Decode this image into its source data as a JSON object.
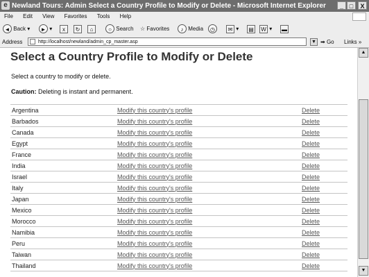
{
  "window": {
    "title": "Newland Tours: Admin Select a Country Profile to Modify or Delete - Microsoft Internet Explorer",
    "buttons": [
      "_",
      "□",
      "X"
    ]
  },
  "menu": [
    "File",
    "Edit",
    "View",
    "Favorites",
    "Tools",
    "Help"
  ],
  "toolbar": {
    "back": "Back",
    "search": "Search",
    "favorites": "Favorites",
    "media": "Media"
  },
  "address": {
    "label": "Address",
    "url": "http://localhost/newland/admin_cp_master.asp",
    "go": "Go",
    "links": "Links"
  },
  "page": {
    "heading": "Select a Country Profile to Modify or Delete",
    "intro": "Select a country to modify or delete.",
    "caution_label": "Caution:",
    "caution_text": "Deleting is instant and permanent."
  },
  "countries": [
    {
      "name": "Argentina",
      "modify": "Modify this country's profile",
      "delete": "Delete"
    },
    {
      "name": "Barbados",
      "modify": "Modify this country's profile",
      "delete": "Delete"
    },
    {
      "name": "Canada",
      "modify": "Modify this country's profile",
      "delete": "Delete"
    },
    {
      "name": "Egypt",
      "modify": "Modify this country's profile",
      "delete": "Delete"
    },
    {
      "name": "France",
      "modify": "Modify this country's profile",
      "delete": "Delete"
    },
    {
      "name": "India",
      "modify": "Modify this country's profile",
      "delete": "Delete"
    },
    {
      "name": "Israel",
      "modify": "Modify this country's profile",
      "delete": "Delete"
    },
    {
      "name": "Italy",
      "modify": "Modify this country's profile",
      "delete": "Delete"
    },
    {
      "name": "Japan",
      "modify": "Modify this country's profile",
      "delete": "Delete"
    },
    {
      "name": "Mexico",
      "modify": "Modify this country's profile",
      "delete": "Delete"
    },
    {
      "name": "Morocco",
      "modify": "Modify this country's profile",
      "delete": "Delete"
    },
    {
      "name": "Namibia",
      "modify": "Modify this country's profile",
      "delete": "Delete"
    },
    {
      "name": "Peru",
      "modify": "Modify this country's profile",
      "delete": "Delete"
    },
    {
      "name": "Taiwan",
      "modify": "Modify this country's profile",
      "delete": "Delete"
    },
    {
      "name": "Thailand",
      "modify": "Modify this country's profile",
      "delete": "Delete"
    }
  ]
}
